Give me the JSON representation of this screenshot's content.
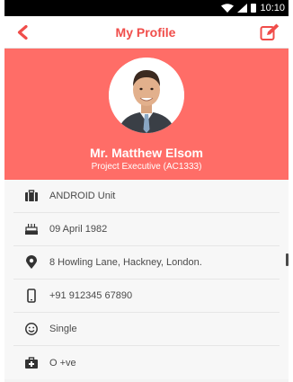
{
  "status": {
    "time": "10:10"
  },
  "app_bar": {
    "title": "My Profile"
  },
  "profile": {
    "name": "Mr. Matthew Elsom",
    "role": "Project Executive (AC1333)"
  },
  "details": [
    {
      "icon": "briefcase-icon",
      "text": "ANDROID Unit"
    },
    {
      "icon": "cake-icon",
      "text": "09 April 1982"
    },
    {
      "icon": "location-pin-icon",
      "text": "8 Howling Lane, Hackney, London."
    },
    {
      "icon": "mobile-phone-icon",
      "text": "+91 912345 67890"
    },
    {
      "icon": "smiley-icon",
      "text": "Single"
    },
    {
      "icon": "medical-kit-icon",
      "text": "O +ve"
    }
  ],
  "colors": {
    "accent": "#f04d4a",
    "hero": "#ff6d67"
  }
}
